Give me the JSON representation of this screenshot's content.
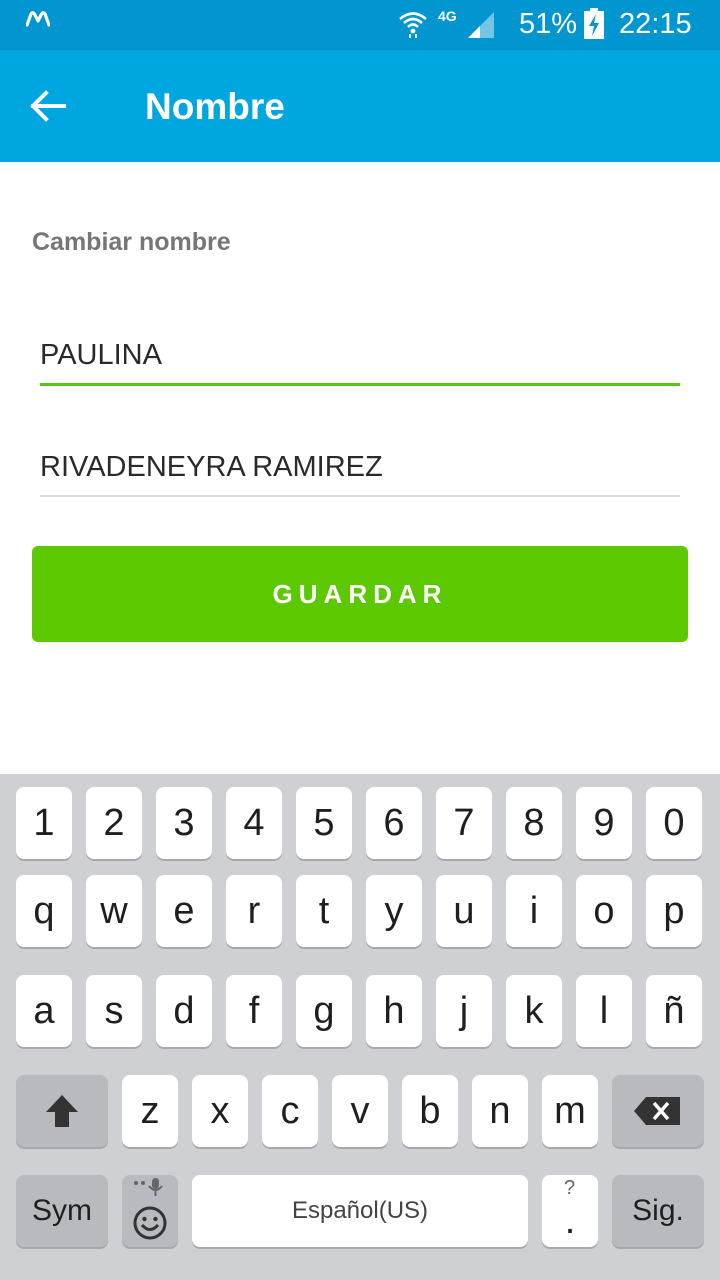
{
  "status_bar": {
    "network_type": "4G",
    "battery_percent": "51%",
    "time": "22:15"
  },
  "app_bar": {
    "title": "Nombre"
  },
  "form": {
    "section_label": "Cambiar nombre",
    "first_name_value": "PAULINA",
    "last_name_value": "RIVADENEYRA RAMIREZ",
    "save_label": "GUARDAR"
  },
  "keyboard": {
    "number_row": [
      "1",
      "2",
      "3",
      "4",
      "5",
      "6",
      "7",
      "8",
      "9",
      "0"
    ],
    "row1": [
      "q",
      "w",
      "e",
      "r",
      "t",
      "y",
      "u",
      "i",
      "o",
      "p"
    ],
    "row2": [
      "a",
      "s",
      "d",
      "f",
      "g",
      "h",
      "j",
      "k",
      "l",
      "ñ"
    ],
    "row3": [
      "z",
      "x",
      "c",
      "v",
      "b",
      "n",
      "m"
    ],
    "sym_label": "Sym",
    "space_label": "Español(US)",
    "next_label": "Sig.",
    "punct_hint": "?",
    "punct_label": "."
  },
  "colors": {
    "status_bar": "#0196cf",
    "app_bar": "#00a6df",
    "accent_green": "#5cc800",
    "keyboard_bg": "#cfd0d4"
  }
}
